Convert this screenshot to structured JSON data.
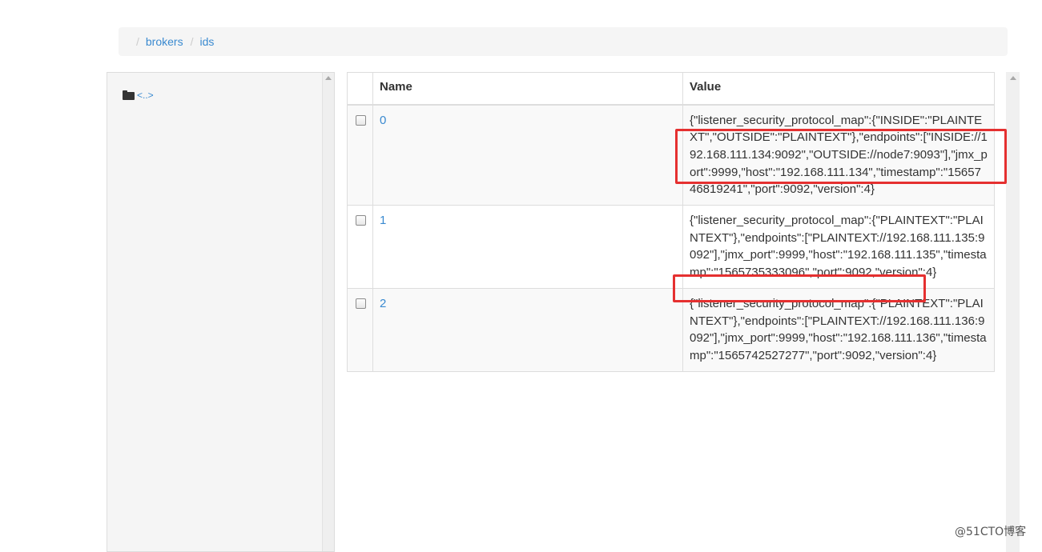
{
  "breadcrumb": {
    "separator": "/",
    "items": [
      {
        "label": "brokers"
      },
      {
        "label": "ids"
      }
    ]
  },
  "tree": {
    "items": [
      {
        "label": "<..>",
        "icon": "folder-icon"
      }
    ]
  },
  "table": {
    "headers": {
      "name": "Name",
      "value": "Value"
    },
    "rows": [
      {
        "name": "0",
        "value": "{\"listener_security_protocol_map\":{\"INSIDE\":\"PLAINTEXT\",\"OUTSIDE\":\"PLAINTEXT\"},\"endpoints\":[\"INSIDE://192.168.111.134:9092\",\"OUTSIDE://node7:9093\"],\"jmx_port\":9999,\"host\":\"192.168.111.134\",\"timestamp\":\"1565746819241\",\"port\":9092,\"version\":4}"
      },
      {
        "name": "1",
        "value": "{\"listener_security_protocol_map\":{\"PLAINTEXT\":\"PLAINTEXT\"},\"endpoints\":[\"PLAINTEXT://192.168.111.135:9092\"],\"jmx_port\":9999,\"host\":\"192.168.111.135\",\"timestamp\":\"1565735333096\",\"port\":9092,\"version\":4}"
      },
      {
        "name": "2",
        "value": "{\"listener_security_protocol_map\":{\"PLAINTEXT\":\"PLAINTEXT\"},\"endpoints\":[\"PLAINTEXT://192.168.111.136:9092\"],\"jmx_port\":9999,\"host\":\"192.168.111.136\",\"timestamp\":\"1565742527277\",\"port\":9092,\"version\":4}"
      }
    ]
  },
  "colors": {
    "link": "#3a8ad0",
    "highlight": "#e53030",
    "stripe": "#f9f9f9"
  },
  "watermark": "@51CTO博客"
}
